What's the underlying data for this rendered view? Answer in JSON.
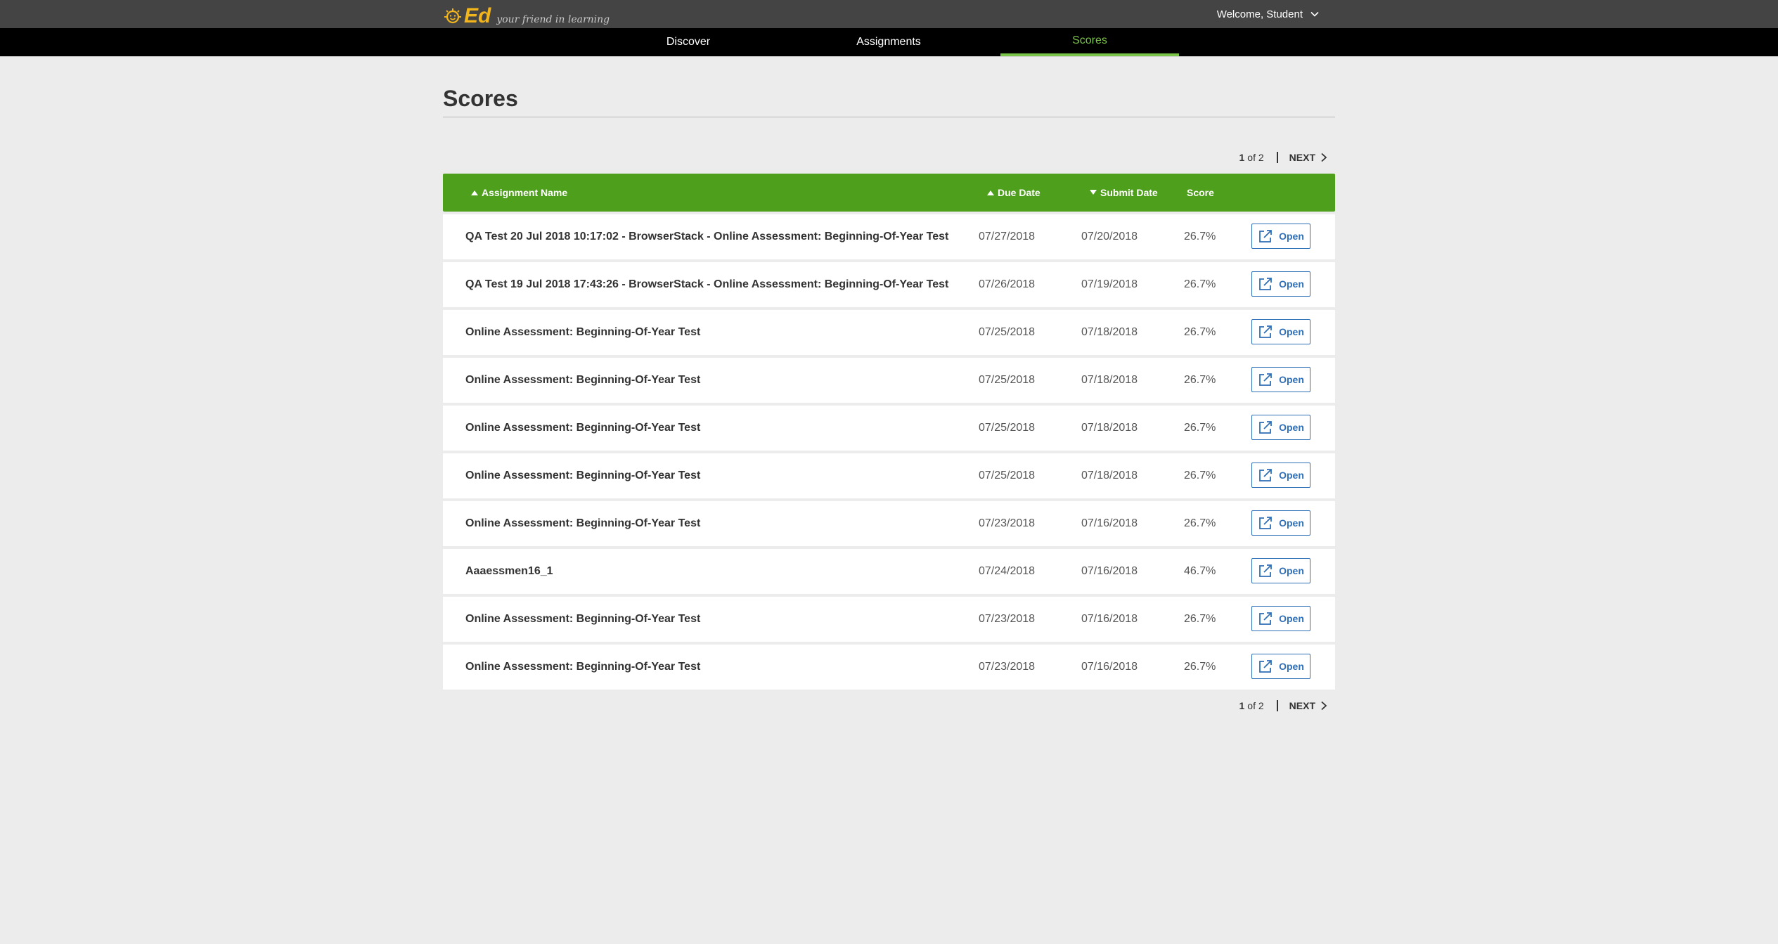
{
  "header": {
    "logo_text": "Ed",
    "tagline": "your friend in learning",
    "welcome": "Welcome, Student"
  },
  "nav": {
    "tabs": [
      {
        "label": "Discover",
        "active": false
      },
      {
        "label": "Assignments",
        "active": false
      },
      {
        "label": "Scores",
        "active": true
      }
    ]
  },
  "page": {
    "title": "Scores"
  },
  "pager": {
    "current": "1",
    "of_text": "of 2",
    "next_label": "NEXT"
  },
  "table": {
    "headers": {
      "name": "Assignment Name",
      "due": "Due Date",
      "submit": "Submit Date",
      "score": "Score"
    },
    "open_label": "Open",
    "rows": [
      {
        "name": "QA Test 20 Jul 2018 10:17:02 - BrowserStack - Online Assessment: Beginning-Of-Year Test",
        "due": "07/27/2018",
        "submit": "07/20/2018",
        "score": "26.7%"
      },
      {
        "name": "QA Test 19 Jul 2018 17:43:26 - BrowserStack - Online Assessment: Beginning-Of-Year Test",
        "due": "07/26/2018",
        "submit": "07/19/2018",
        "score": "26.7%"
      },
      {
        "name": "Online Assessment: Beginning-Of-Year Test",
        "due": "07/25/2018",
        "submit": "07/18/2018",
        "score": "26.7%"
      },
      {
        "name": "Online Assessment: Beginning-Of-Year Test",
        "due": "07/25/2018",
        "submit": "07/18/2018",
        "score": "26.7%"
      },
      {
        "name": "Online Assessment: Beginning-Of-Year Test",
        "due": "07/25/2018",
        "submit": "07/18/2018",
        "score": "26.7%"
      },
      {
        "name": "Online Assessment: Beginning-Of-Year Test",
        "due": "07/25/2018",
        "submit": "07/18/2018",
        "score": "26.7%"
      },
      {
        "name": "Online Assessment: Beginning-Of-Year Test",
        "due": "07/23/2018",
        "submit": "07/16/2018",
        "score": "26.7%"
      },
      {
        "name": "Aaaessmen16_1",
        "due": "07/24/2018",
        "submit": "07/16/2018",
        "score": "46.7%"
      },
      {
        "name": "Online Assessment: Beginning-Of-Year Test",
        "due": "07/23/2018",
        "submit": "07/16/2018",
        "score": "26.7%"
      },
      {
        "name": "Online Assessment: Beginning-Of-Year Test",
        "due": "07/23/2018",
        "submit": "07/16/2018",
        "score": "26.7%"
      }
    ]
  },
  "colors": {
    "header_bg": "#444444",
    "nav_bg": "#000000",
    "accent_green": "#7bc44a",
    "table_header_green": "#4e9f1b",
    "link_blue": "#2e6fb6",
    "logo_orange": "#f2b51c"
  }
}
